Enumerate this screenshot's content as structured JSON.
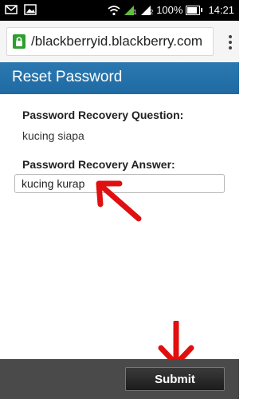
{
  "status_bar": {
    "battery_label": "100%",
    "battery_level": 1.0,
    "time": "14:21",
    "signal_label_1": "1",
    "signal_label_2": "2"
  },
  "browser": {
    "url": "/blackberryid.blackberry.com"
  },
  "page": {
    "title": "Reset Password"
  },
  "form": {
    "question_label": "Password Recovery Question:",
    "question_value": "kucing siapa",
    "answer_label": "Password Recovery Answer:",
    "answer_value": "kucing kurap"
  },
  "footer": {
    "submit_label": "Submit"
  },
  "colors": {
    "header_blue": "#2b78b0",
    "annotation_red": "#e01010",
    "footer_gray": "#4a4a4a"
  }
}
